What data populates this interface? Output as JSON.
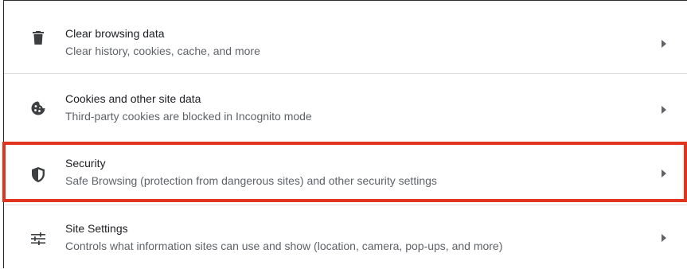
{
  "settings": {
    "items": [
      {
        "title": "Clear browsing data",
        "subtitle": "Clear history, cookies, cache, and more",
        "icon": "trash-icon"
      },
      {
        "title": "Cookies and other site data",
        "subtitle": "Third-party cookies are blocked in Incognito mode",
        "icon": "cookie-icon"
      },
      {
        "title": "Security",
        "subtitle": "Safe Browsing (protection from dangerous sites) and other security settings",
        "icon": "shield-icon"
      },
      {
        "title": "Site Settings",
        "subtitle": "Controls what information sites can use and show (location, camera, pop-ups, and more)",
        "icon": "tune-icon"
      }
    ]
  },
  "colors": {
    "highlight_border": "#e0341e",
    "title_text": "#202124",
    "subtitle_text": "#5f6368",
    "icon": "#3c4043",
    "divider": "#dadce0"
  }
}
